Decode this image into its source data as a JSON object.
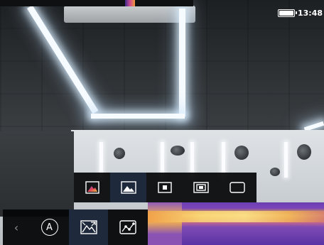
{
  "status": {
    "time": "13:48",
    "battery_level": 1.0
  },
  "submenu": {
    "options": [
      {
        "name": "palette-mode",
        "icon": "thermal-palette-icon",
        "selected": false
      },
      {
        "name": "visible-image-mode",
        "icon": "landscape-image-icon",
        "selected": true
      },
      {
        "name": "center-spot-mode",
        "icon": "small-square-icon",
        "selected": false
      },
      {
        "name": "picture-in-picture-mode",
        "icon": "pip-frame-icon",
        "selected": false
      },
      {
        "name": "full-frame-mode",
        "icon": "rounded-rect-icon",
        "selected": false
      }
    ]
  },
  "mainbar": {
    "back_glyph": "‹",
    "auto_label": "A",
    "items": [
      {
        "name": "auto-mode",
        "icon": "auto-circle-icon",
        "selected": false
      },
      {
        "name": "image-fusion",
        "icon": "image-fusion-icon",
        "selected": true
      },
      {
        "name": "measurement-curve",
        "icon": "curve-points-icon",
        "selected": false
      }
    ]
  },
  "colors": {
    "accent_selected": "#1e2a3c",
    "bar_background": "#050607",
    "thermal_hot": "#fbe08a",
    "thermal_cold": "#5b33a4"
  }
}
